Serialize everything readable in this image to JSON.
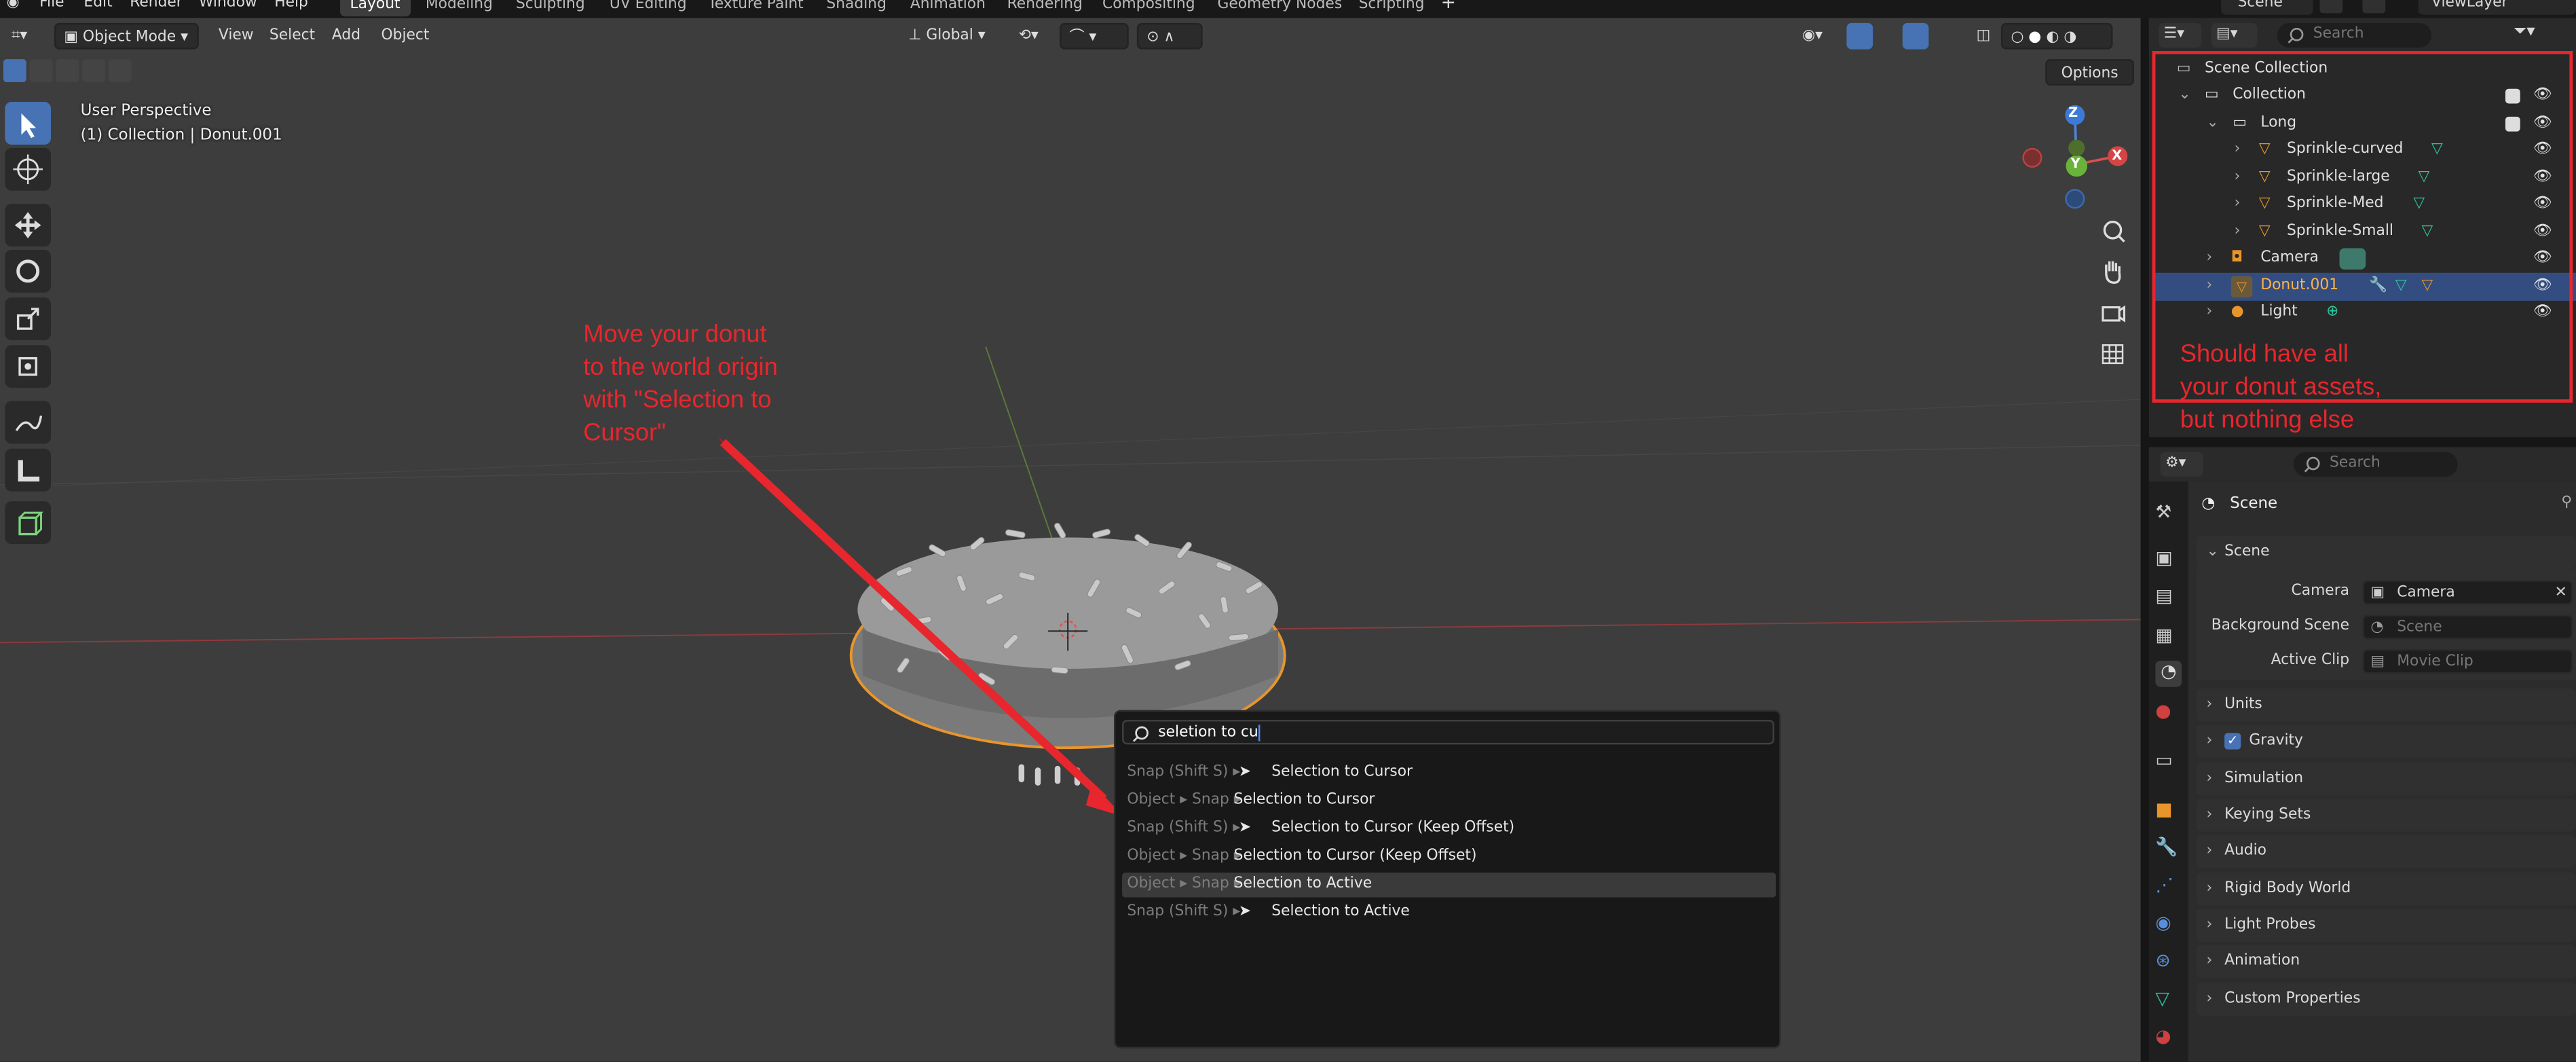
{
  "topbar": {
    "menus": [
      "File",
      "Edit",
      "Render",
      "Window",
      "Help"
    ],
    "workspaces": [
      "Layout",
      "Modeling",
      "Sculpting",
      "UV Editing",
      "Texture Paint",
      "Shading",
      "Animation",
      "Rendering",
      "Compositing",
      "Geometry Nodes",
      "Scripting"
    ],
    "active_workspace": "Layout",
    "scene": "Scene",
    "view_layer": "ViewLayer"
  },
  "viewport_header": {
    "mode": "Object Mode",
    "menus": [
      "View",
      "Select",
      "Add",
      "Object"
    ],
    "orientation": "Global",
    "options": "Options"
  },
  "viewport_overlay": {
    "perspective": "User Perspective",
    "collection_info": "(1) Collection | Donut.001",
    "gizmo": {
      "z": "Z",
      "y": "Y",
      "x": "X"
    }
  },
  "annotations": {
    "donut_note": [
      "Move your donut",
      "to the world origin",
      "with \"Selection to",
      "Cursor\""
    ],
    "outliner_note": [
      "Should have all",
      "your donut assets,",
      "but nothing else"
    ],
    "color": "#e8262d"
  },
  "search_popup": {
    "query": "seletion to cu",
    "results": [
      {
        "prefix": "Snap (Shift S) ▸",
        "label": "Selection to Cursor",
        "icon": true
      },
      {
        "prefix": "Object ▸ Snap ▸",
        "label": "Selection to Cursor",
        "icon": false
      },
      {
        "prefix": "Snap (Shift S) ▸",
        "label": "Selection to Cursor (Keep Offset)",
        "icon": true
      },
      {
        "prefix": "Object ▸ Snap ▸",
        "label": "Selection to Cursor (Keep Offset)",
        "icon": false
      },
      {
        "prefix": "Object ▸ Snap ▸",
        "label": "Selection to Active",
        "icon": false,
        "highlighted": true
      },
      {
        "prefix": "Snap (Shift S) ▸",
        "label": "Selection to Active",
        "icon": true
      }
    ]
  },
  "outliner": {
    "search_placeholder": "Search",
    "items": [
      {
        "label": "Scene Collection",
        "indent": 0
      },
      {
        "label": "Collection",
        "indent": 1
      },
      {
        "label": "Long",
        "indent": 2
      },
      {
        "label": "Sprinkle-curved",
        "indent": 3
      },
      {
        "label": "Sprinkle-large",
        "indent": 3
      },
      {
        "label": "Sprinkle-Med",
        "indent": 3
      },
      {
        "label": "Sprinkle-Small",
        "indent": 3
      },
      {
        "label": "Camera",
        "indent": 2
      },
      {
        "label": "Donut.001",
        "indent": 2,
        "selected": true
      },
      {
        "label": "Light",
        "indent": 2
      }
    ]
  },
  "properties": {
    "search_placeholder": "Search",
    "context": "Scene",
    "panel_title": "Scene",
    "fields": [
      {
        "label": "Camera",
        "value": "Camera"
      },
      {
        "label": "Background Scene",
        "value": "Scene"
      },
      {
        "label": "Active Clip",
        "value": "Movie Clip"
      }
    ],
    "panels": [
      "Units",
      "Gravity",
      "Simulation",
      "Keying Sets",
      "Audio",
      "Rigid Body World",
      "Light Probes",
      "Animation",
      "Custom Properties"
    ],
    "gravity_checked": true
  }
}
